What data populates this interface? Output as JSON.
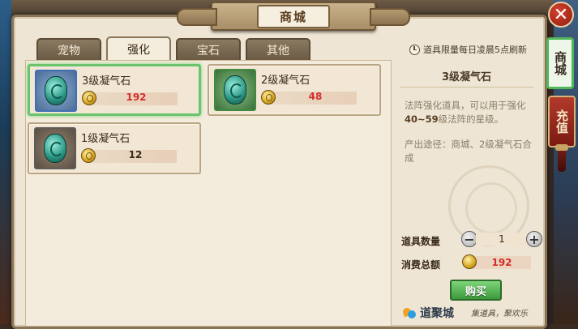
{
  "window": {
    "title": "商城",
    "close_symbol": "✕"
  },
  "side_tabs": [
    {
      "label": "商城",
      "active": true
    },
    {
      "label": "充值",
      "active": false
    }
  ],
  "tabs": [
    {
      "label": "宠物",
      "active": false
    },
    {
      "label": "强化",
      "active": true
    },
    {
      "label": "宝石",
      "active": false
    },
    {
      "label": "其他",
      "active": false
    }
  ],
  "notice": "道具限量每日凌晨5点刷新",
  "items": [
    {
      "name": "3级凝气石",
      "price": "192",
      "price_color": "red",
      "selected": true,
      "frame": "blue"
    },
    {
      "name": "2级凝气石",
      "price": "48",
      "price_color": "red",
      "selected": false,
      "frame": "green"
    },
    {
      "name": "1级凝气石",
      "price": "12",
      "price_color": "dark",
      "selected": false,
      "frame": "gray"
    }
  ],
  "detail": {
    "title": "3级凝气石",
    "description_prefix": "法阵强化道具，可以用于强化",
    "description_range": "40~59",
    "description_suffix": "级法阵的星级。",
    "source": "产出途径：商城、2级凝气石合成",
    "quantity_label": "道具数量",
    "quantity_value": "1",
    "total_label": "消费总额",
    "total_value": "192",
    "buy_label": "购买"
  },
  "watermark": {
    "brand_name": "道聚城",
    "slogan": "集道具，聚欢乐"
  },
  "icons": {
    "item_icon": "green-gem-icon",
    "currency_icon": "gold-coin-icon",
    "close_icon": "close-icon",
    "clock_icon": "clock-icon"
  },
  "colors": {
    "selected_border": "#6bc46d",
    "price_red": "#d32e2a",
    "buy_green": "#3c9a3a",
    "recharge_red": "#b23a2a"
  }
}
